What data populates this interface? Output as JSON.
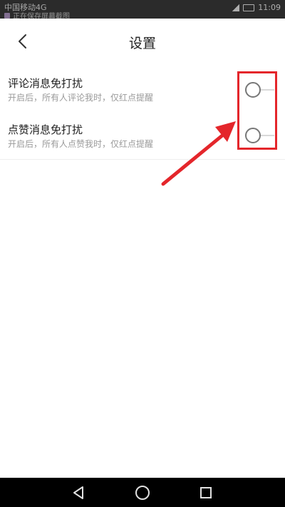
{
  "status_bar": {
    "left_text": "中国移动4G",
    "notice_text": "正在保存屏幕截图",
    "time": "11:09"
  },
  "header": {
    "title": "设置",
    "back_icon": "chevron-left-icon"
  },
  "settings": [
    {
      "title": "评论消息免打扰",
      "description": "开启后，所有人评论我时，仅红点提醒",
      "enabled": false
    },
    {
      "title": "点赞消息免打扰",
      "description": "开启后，所有人点赞我时，仅红点提醒",
      "enabled": false
    }
  ],
  "annotation": {
    "color": "#e4262b",
    "type": "highlight-box-with-arrow"
  },
  "nav_bar": {
    "icons": [
      "back-triangle-icon",
      "home-circle-icon",
      "recent-square-icon"
    ]
  }
}
